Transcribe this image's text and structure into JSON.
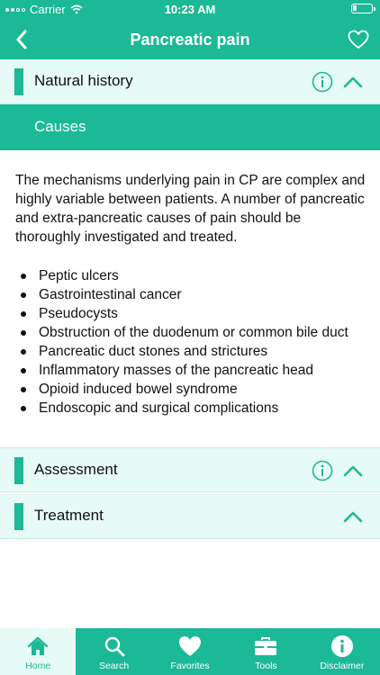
{
  "status_bar": {
    "carrier": "Carrier",
    "time": "10:23 AM"
  },
  "nav": {
    "title": "Pancreatic pain",
    "back_icon": "chevron-left-icon",
    "favorite_icon": "heart-outline-icon"
  },
  "sections": [
    {
      "label": "Natural history",
      "has_info": true,
      "expanded": true
    },
    {
      "label": "Assessment",
      "has_info": true,
      "expanded": true
    },
    {
      "label": "Treatment",
      "has_info": false,
      "expanded": true
    }
  ],
  "subsection": {
    "label": "Causes"
  },
  "content": {
    "paragraph": "The mechanisms underlying pain in CP are complex and highly variable between patients. A number of pancreatic and extra-pancreatic causes of pain should be thoroughly investigated and treated.",
    "bullets": [
      "Peptic ulcers",
      "Gastrointestinal cancer",
      "Pseudocysts",
      "Obstruction of the duodenum or common bile duct",
      "Pancreatic duct stones and strictures",
      "Inflammatory masses of the pancreatic head",
      "Opioid induced bowel syndrome",
      "Endoscopic and surgical complications"
    ]
  },
  "tabs": [
    {
      "label": "Home",
      "icon": "home-icon",
      "active": true
    },
    {
      "label": "Search",
      "icon": "search-icon",
      "active": false
    },
    {
      "label": "Favorites",
      "icon": "heart-icon",
      "active": false
    },
    {
      "label": "Tools",
      "icon": "toolbox-icon",
      "active": false
    },
    {
      "label": "Disclaimer",
      "icon": "info-icon",
      "active": false
    }
  ],
  "colors": {
    "accent": "#1bb996",
    "section_bg": "#e6faf6",
    "text": "#111111"
  }
}
